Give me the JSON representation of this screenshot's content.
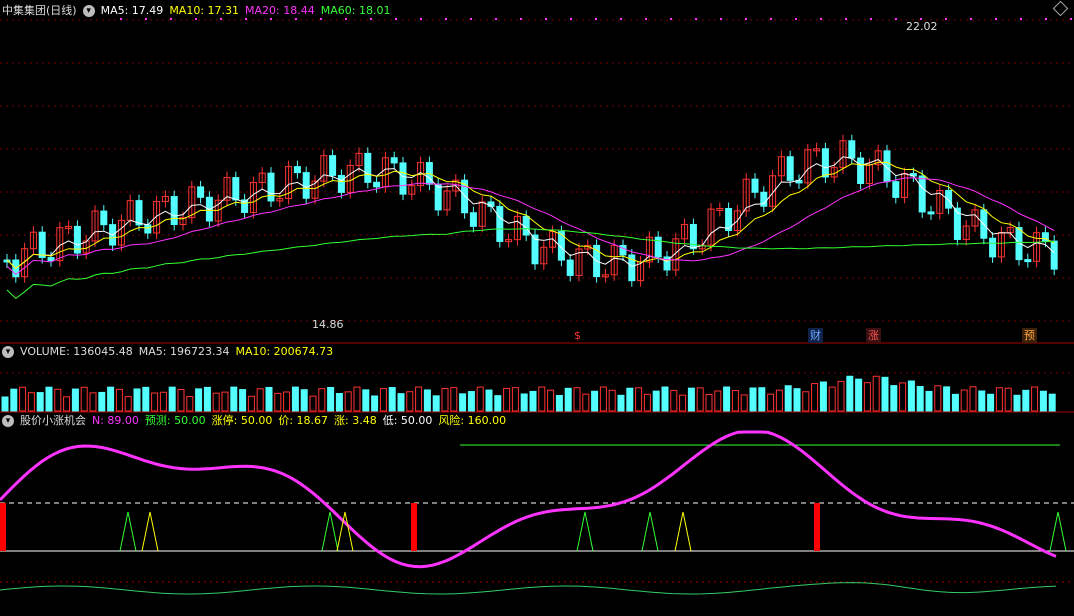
{
  "price_panel": {
    "stock_name": "中集集团(日线)",
    "ma5_label": "MA5: 17.49",
    "ma10_label": "MA10: 17.31",
    "ma20_label": "MA20: 18.44",
    "ma60_label": "MA60: 18.01",
    "high_label": "22.02",
    "low_label": "14.86",
    "colors": {
      "ma5": "#ffffff",
      "ma10": "#ffff00",
      "ma20": "#ff33ff",
      "ma60": "#33ff33",
      "up": "#ff3333",
      "down": "#54ffff"
    }
  },
  "events": [
    {
      "label": "$",
      "color": "#ff3333"
    },
    {
      "label": "财",
      "color": "#6aa8ff"
    },
    {
      "label": "涨",
      "color": "#ff5555"
    },
    {
      "label": "预",
      "color": "#ffaa44"
    }
  ],
  "volume_panel": {
    "volume_label": "VOLUME: 136045.48",
    "ma5_label": "MA5: 196723.34",
    "ma10_label": "MA10: 200674.73"
  },
  "indicator_panel": {
    "name": "股价小涨机会",
    "n_label": "N: 89.00",
    "forecast_label": "预测: 50.00",
    "limit_label": "涨停: 50.00",
    "price_label": "价: 18.67",
    "rise_label": "涨: 3.48",
    "low_label": "低: 50.00",
    "risk_label": "风险: 160.00"
  }
}
